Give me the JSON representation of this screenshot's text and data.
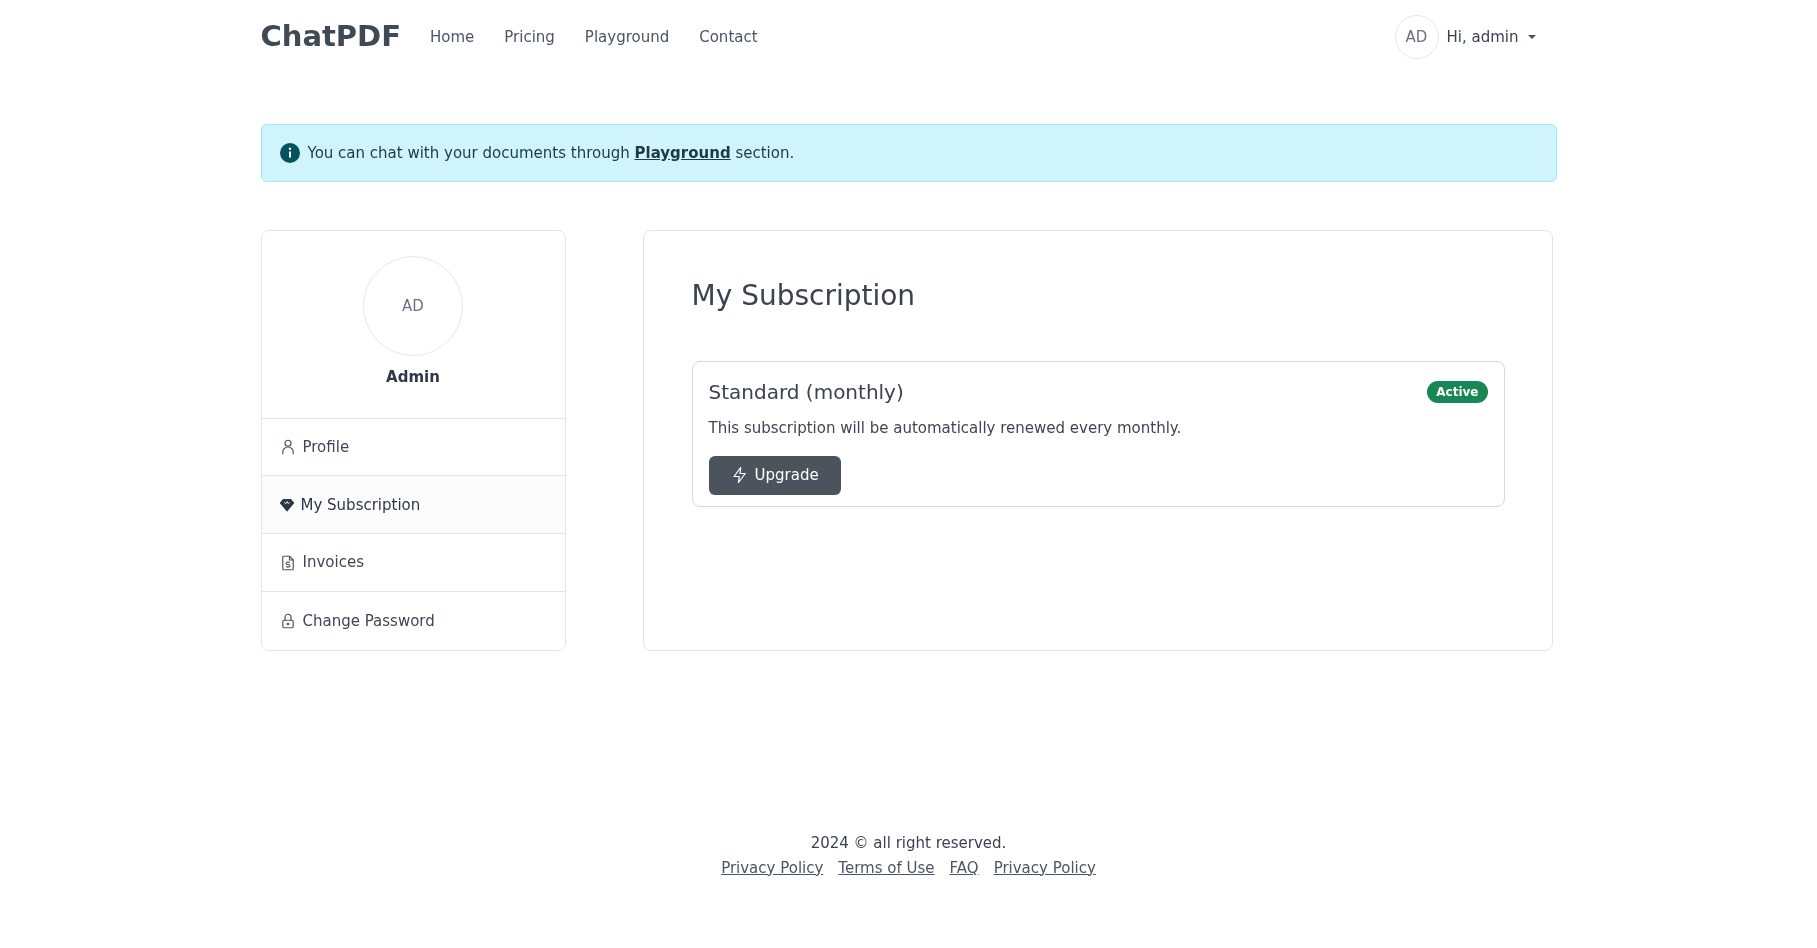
{
  "header": {
    "logo": "ChatPDF",
    "nav": [
      {
        "label": "Home"
      },
      {
        "label": "Pricing"
      },
      {
        "label": "Playground"
      },
      {
        "label": "Contact"
      }
    ],
    "user": {
      "initials": "AD",
      "greeting": "Hi, admin"
    }
  },
  "alert": {
    "before": "You can chat with your documents through",
    "link": "Playground",
    "after": "section."
  },
  "sidebar": {
    "initials": "AD",
    "name": "Admin",
    "items": [
      {
        "label": "Profile",
        "selected": false
      },
      {
        "label": "My Subscription",
        "selected": true
      },
      {
        "label": "Invoices",
        "selected": false
      },
      {
        "label": "Change Password",
        "selected": false
      }
    ]
  },
  "main": {
    "title": "My Subscription",
    "subscription": {
      "plan": "Standard (monthly)",
      "status": "Active",
      "active": true,
      "description": "This subscription will be automatically renewed every monthly.",
      "button": "Upgrade"
    }
  },
  "footer": {
    "copyright": "2024 © all right reserved.",
    "links": [
      "Privacy Policy",
      "Terms of Use",
      "FAQ",
      "Privacy Policy"
    ]
  }
}
